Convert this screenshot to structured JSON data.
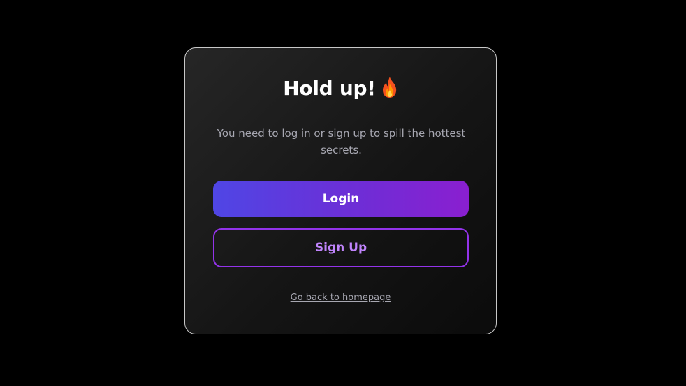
{
  "modal": {
    "title": "Hold up!",
    "title_icon": "fire-icon",
    "message": "You need to log in or sign up to spill the hottest secrets.",
    "login_label": "Login",
    "signup_label": "Sign Up",
    "back_link_label": "Go back to homepage"
  },
  "colors": {
    "background": "#000000",
    "card_border": "#c8c8c8",
    "login_gradient_start": "#4f46e5",
    "login_gradient_end": "#8a1fd0",
    "signup_border": "#9333ea",
    "signup_text": "#c084fc",
    "muted_text": "#a7a7b1"
  }
}
